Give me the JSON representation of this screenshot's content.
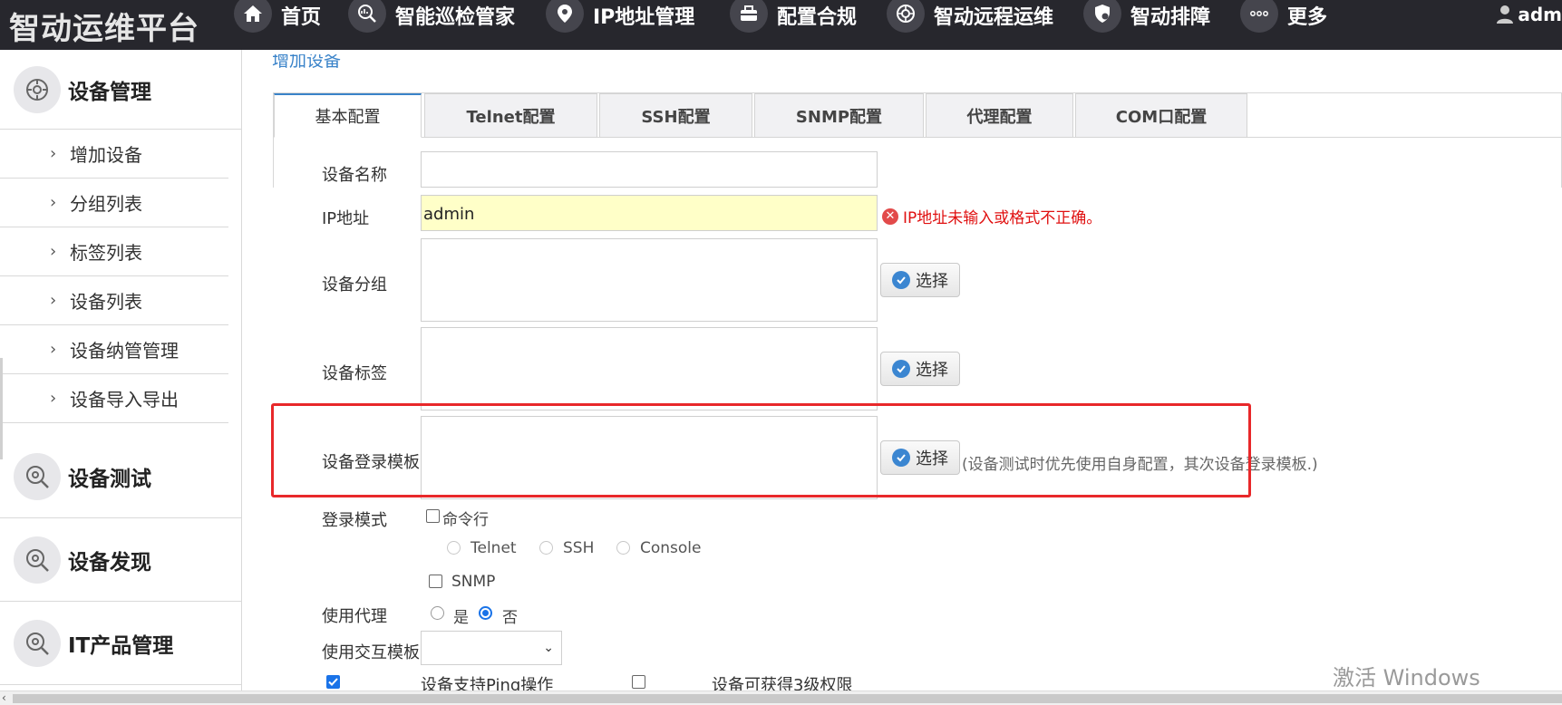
{
  "app": {
    "title": "智动运维平台"
  },
  "nav": [
    {
      "label": "首页",
      "icon": "home-icon"
    },
    {
      "label": "智能巡检管家",
      "icon": "inspection-icon"
    },
    {
      "label": "IP地址管理",
      "icon": "location-pin-icon"
    },
    {
      "label": "配置合规",
      "icon": "toolbox-icon"
    },
    {
      "label": "智动远程运维",
      "icon": "remote-icon"
    },
    {
      "label": "智动排障",
      "icon": "shield-gear-icon"
    },
    {
      "label": "更多",
      "icon": "more-dots-icon"
    }
  ],
  "user": {
    "name": "adm"
  },
  "sidebar": {
    "sections": [
      {
        "label": "设备管理",
        "icon": "device-management-icon"
      },
      {
        "label": "设备测试",
        "icon": "device-test-icon"
      },
      {
        "label": "设备发现",
        "icon": "device-discovery-icon"
      },
      {
        "label": "IT产品管理",
        "icon": "it-product-icon"
      }
    ],
    "items": [
      "增加设备",
      "分组列表",
      "标签列表",
      "设备列表",
      "设备纳管管理",
      "设备导入导出"
    ]
  },
  "page": {
    "title": "增加设备"
  },
  "tabs": [
    "基本配置",
    "Telnet配置",
    "SSH配置",
    "SNMP配置",
    "代理配置",
    "COM口配置"
  ],
  "form": {
    "device_name_label": "设备名称",
    "ip_label": "IP地址",
    "ip_value": "admin",
    "ip_error": "IP地址未输入或格式不正确。",
    "group_label": "设备分组",
    "tag_label": "设备标签",
    "template_label": "设备登录模板",
    "select_label": "选择",
    "template_hint": "(设备测试时优先使用自身配置，其次设备登录模板.)",
    "login_mode_label": "登录模式",
    "cmdline_label": "命令行",
    "telnet_label": "Telnet",
    "ssh_label": "SSH",
    "console_label": "Console",
    "snmp_label": "SNMP",
    "proxy_label": "使用代理",
    "yes_label": "是",
    "no_label": "否",
    "interact_label": "使用交互模板",
    "ping_label": "设备支持Ping操作",
    "level3_label": "设备可获得3级权限"
  },
  "watermark": "激活 Windows",
  "colors": {
    "nav_bg": "#27272d",
    "accent": "#3a83c9",
    "error": "#e01010",
    "highlight_box": "#e8282a"
  }
}
